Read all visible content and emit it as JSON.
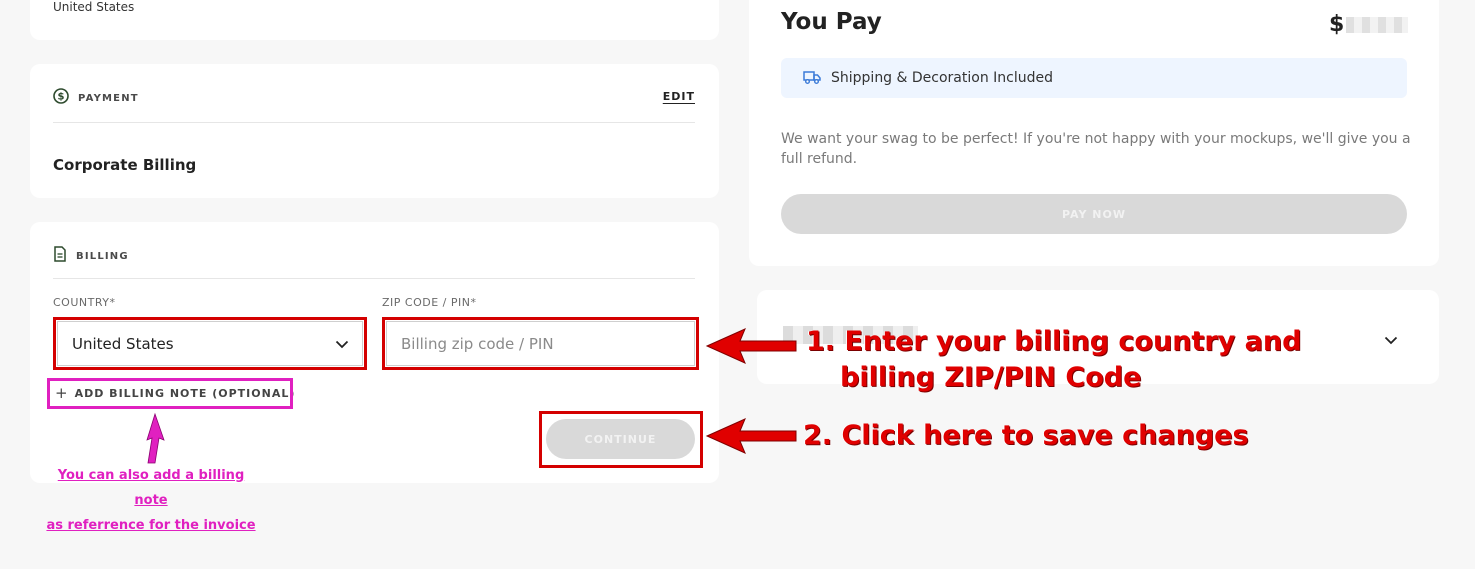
{
  "address_card": {
    "country_line": "United States"
  },
  "payment": {
    "section_title": "PAYMENT",
    "edit_label": "EDIT",
    "method": "Corporate Billing"
  },
  "billing": {
    "section_title": "BILLING",
    "country_label": "COUNTRY*",
    "country_value": "United States",
    "zip_label": "ZIP CODE / PIN*",
    "zip_placeholder": "Billing zip code / PIN",
    "zip_value": "",
    "add_note_label": "ADD BILLING NOTE (OPTIONAL)",
    "continue_label": "CONTINUE"
  },
  "summary": {
    "you_pay_label": "You Pay",
    "amount_prefix": "$",
    "shipping_banner": "Shipping & Decoration Included",
    "guarantee_text": "We want your swag to be perfect! If you're not happy with your mockups, we'll give you a full refund.",
    "pay_now_label": "PAY NOW"
  },
  "annotations": {
    "step1_line1": "1. Enter your billing country and",
    "step1_line2": "billing ZIP/PIN Code",
    "step2": "2. Click here to save changes",
    "note_line1": "You can also add a billing note",
    "note_line2": "as referrence for the invoice"
  },
  "colors": {
    "annotation_red": "#d40000",
    "annotation_pink": "#e020c0",
    "banner_bg": "#eef5ff",
    "disabled_button": "#d9d9d9"
  },
  "icons": {
    "payment": "dollar-circle-icon",
    "billing": "document-icon",
    "country_select": "chevron-down-icon",
    "add_note": "plus-icon",
    "shipping": "truck-icon",
    "accordion": "chevron-down-icon"
  }
}
